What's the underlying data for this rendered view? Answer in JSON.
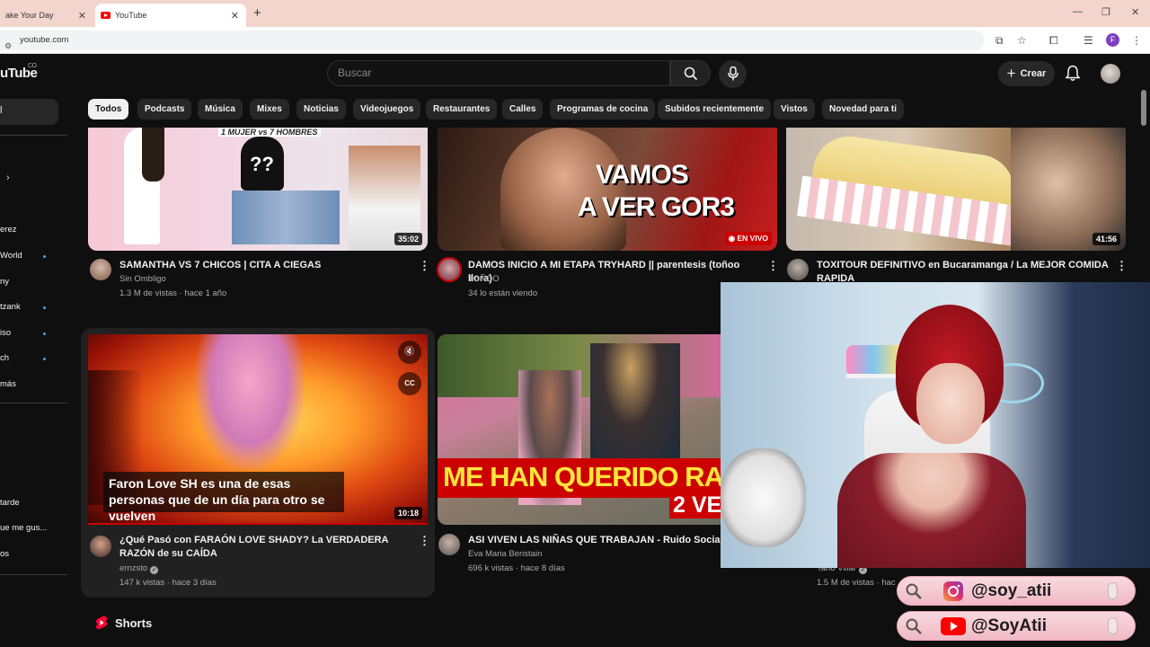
{
  "browser": {
    "tabs": [
      {
        "title": "ake Your Day"
      },
      {
        "title": "YouTube"
      }
    ],
    "url": "youtube.com",
    "profile_initial": "F"
  },
  "header": {
    "logo": "uTube",
    "country": "CO",
    "search_placeholder": "Buscar",
    "create_label": "Crear"
  },
  "chips": [
    "Todos",
    "Podcasts",
    "Música",
    "Mixes",
    "Noticias",
    "Videojuegos",
    "Restaurantes",
    "Calles",
    "Programas de cocina",
    "Subidos recientemente",
    "Vistos",
    "Novedad para ti"
  ],
  "sidebar": {
    "items": [
      "erez",
      "World",
      "ny",
      "tzank",
      "iso",
      "ch",
      "más",
      "tarde",
      "ue me gus...",
      "os"
    ]
  },
  "videos": [
    {
      "title": "SAMANTHA VS 7 CHICOS  | CITA A CIEGAS",
      "channel": "Sin Ombligo",
      "meta": "1.3 M de vistas · hace 1 año",
      "duration": "35:02",
      "thumb_text": "1 MUJER vs 7 HOMBRES"
    },
    {
      "title": "DAMOS INICIO A MI ETAPA TRYHARD || parentesis (toñoo llora)",
      "channel": "TOÑOO",
      "meta": "34 lo están viendo",
      "live_badge": "EN VIVO",
      "thumb_text_1": "VAMOS",
      "thumb_text_2": "A VER GOR3"
    },
    {
      "title": "TOXITOUR DEFINITIVO en Bucaramanga / La MEJOR COMIDA RAPIDA",
      "duration": "41:56"
    },
    {
      "title": "¿Qué Pasó con FARAÓN LOVE SHADY? La VERDADERA RAZÓN de su CAÍDA",
      "channel": "ernzsto",
      "meta": "147 k vistas · hace 3 días",
      "duration": "10:18",
      "caption": "Faron Love SH es una de esas personas que de un día para otro se vuelven"
    },
    {
      "title": "ASI VIVEN LAS NIÑAS QUE TRABAJAN - Ruido Social",
      "channel": "Eva Maria Beristain",
      "meta": "696 k vistas · hace 8 días",
      "thumb_text": "ME HAN QUERIDO RAPT*R",
      "thumb_text_2": "2 VE"
    },
    {
      "channel": "Tano Villar",
      "meta": "1.5 M de vistas · hac"
    }
  ],
  "section": {
    "shorts": "Shorts"
  },
  "social": {
    "instagram": "@soy_atii",
    "youtube": "@SoyAtii"
  }
}
